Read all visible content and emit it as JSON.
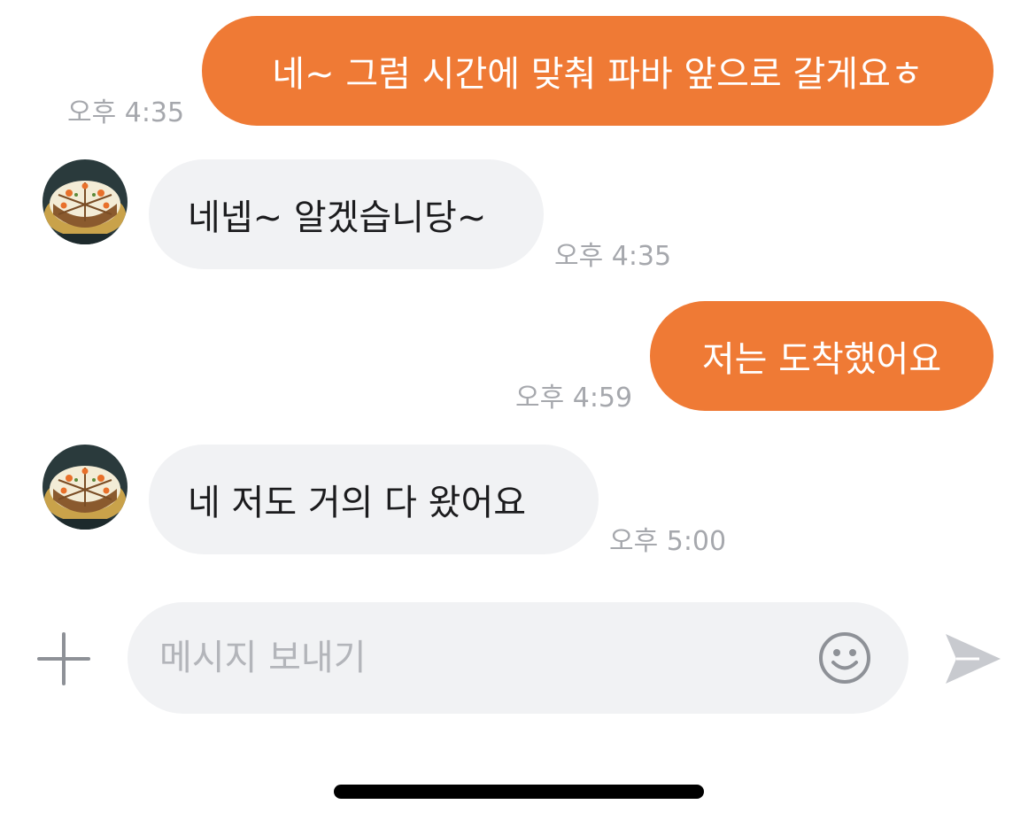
{
  "messages": [
    {
      "from": "me",
      "text": "네~ 그럼 시간에 맞춰 파바 앞으로 갈게요ㅎ",
      "time": "오후 4:35"
    },
    {
      "from": "other",
      "text": "네넵~ 알겠습니당~",
      "time": "오후 4:35"
    },
    {
      "from": "me",
      "text": "저는 도착했어요",
      "time": "오후 4:59"
    },
    {
      "from": "other",
      "text": "네 저도 거의 다 왔어요",
      "time": "오후 5:00"
    }
  ],
  "composer": {
    "placeholder": "메시지 보내기",
    "value": ""
  },
  "icons": {
    "add": "plus-icon",
    "emoji": "smiley-icon",
    "send": "paper-plane-icon",
    "avatar": "cake-photo"
  },
  "colors": {
    "sent_bubble": "#ef7a35",
    "received_bubble": "#f1f2f4",
    "timestamp": "#a6a8ad",
    "icon": "#8e9197",
    "send_icon": "#c8cacf"
  }
}
